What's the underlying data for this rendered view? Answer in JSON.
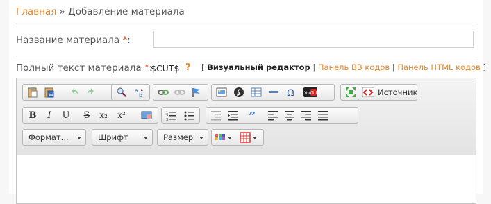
{
  "breadcrumb": {
    "home": "Главная",
    "separator": " » ",
    "current": "Добавление материала"
  },
  "form": {
    "title_label": "Название материала ",
    "title_required": "*",
    "title_colon": ":",
    "title_value": "",
    "text_label": "Полный текст материала ",
    "text_required": "*",
    "text_colon": ":",
    "cut_tag": "$CUT$",
    "help": "?"
  },
  "editor_modes": {
    "open_bracket": "[ ",
    "visual": "Визуальный редактор",
    "sep": " | ",
    "bb": "Панель BB кодов",
    "html": "Панель HTML кодов",
    "close_bracket": " ]"
  },
  "toolbar": {
    "source_label": "Источник",
    "bold": "B",
    "italic": "I",
    "underline": "U",
    "strike": "S",
    "subscript": "x₂",
    "superscript": "x²",
    "format_label": "Формат...",
    "font_label": "Шрифт",
    "size_label": "Размер"
  },
  "colors": {
    "accent": "#e8872a",
    "required": "#e24b1e"
  }
}
